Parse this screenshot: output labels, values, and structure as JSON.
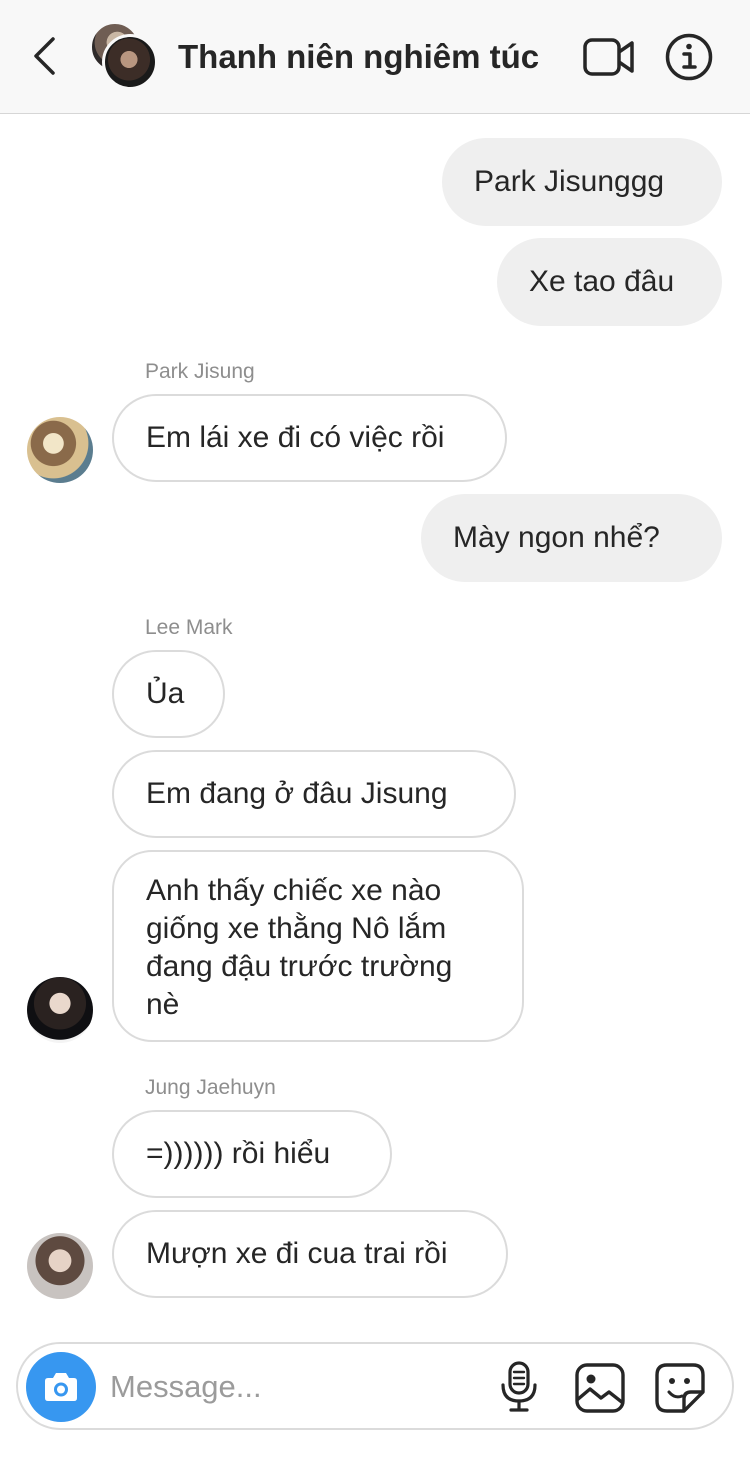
{
  "header": {
    "title": "Thanh niên nghiêm túc",
    "back_icon": "chevron-left-icon",
    "video_icon": "video-camera-icon",
    "info_icon": "info-icon"
  },
  "messages": [
    {
      "sender": "me",
      "text": "Park Jisunggg"
    },
    {
      "sender": "me",
      "text": "Xe tao đâu"
    },
    {
      "sender_name": "Park Jisung",
      "text": "Em lái xe đi có việc rồi"
    },
    {
      "sender": "me",
      "text": "Mày ngon nhể?"
    },
    {
      "sender_name": "Lee Mark",
      "text": "Ủa"
    },
    {
      "sender_name": "Lee Mark",
      "text": "Em đang ở đâu Jisung"
    },
    {
      "sender_name": "Lee Mark",
      "text": "Anh thấy chiếc xe nào giống xe thằng Nô lắm đang đậu trước trường nè"
    },
    {
      "sender_name": "Jung Jaehuyn",
      "text": "=)))))) rồi hiểu"
    },
    {
      "sender_name": "Jung Jaehuyn",
      "text": "Mượn xe đi cua trai rồi"
    }
  ],
  "composer": {
    "placeholder": "Message...",
    "camera_icon": "camera-icon",
    "mic_icon": "microphone-icon",
    "gallery_icon": "image-gallery-icon",
    "sticker_icon": "sticker-icon"
  },
  "colors": {
    "header_bg": "#f8f8f8",
    "outgoing_bubble": "#efefef",
    "incoming_border": "#dbdbdb",
    "sender_name": "#8e8e8e",
    "camera_button": "#3797f0"
  }
}
